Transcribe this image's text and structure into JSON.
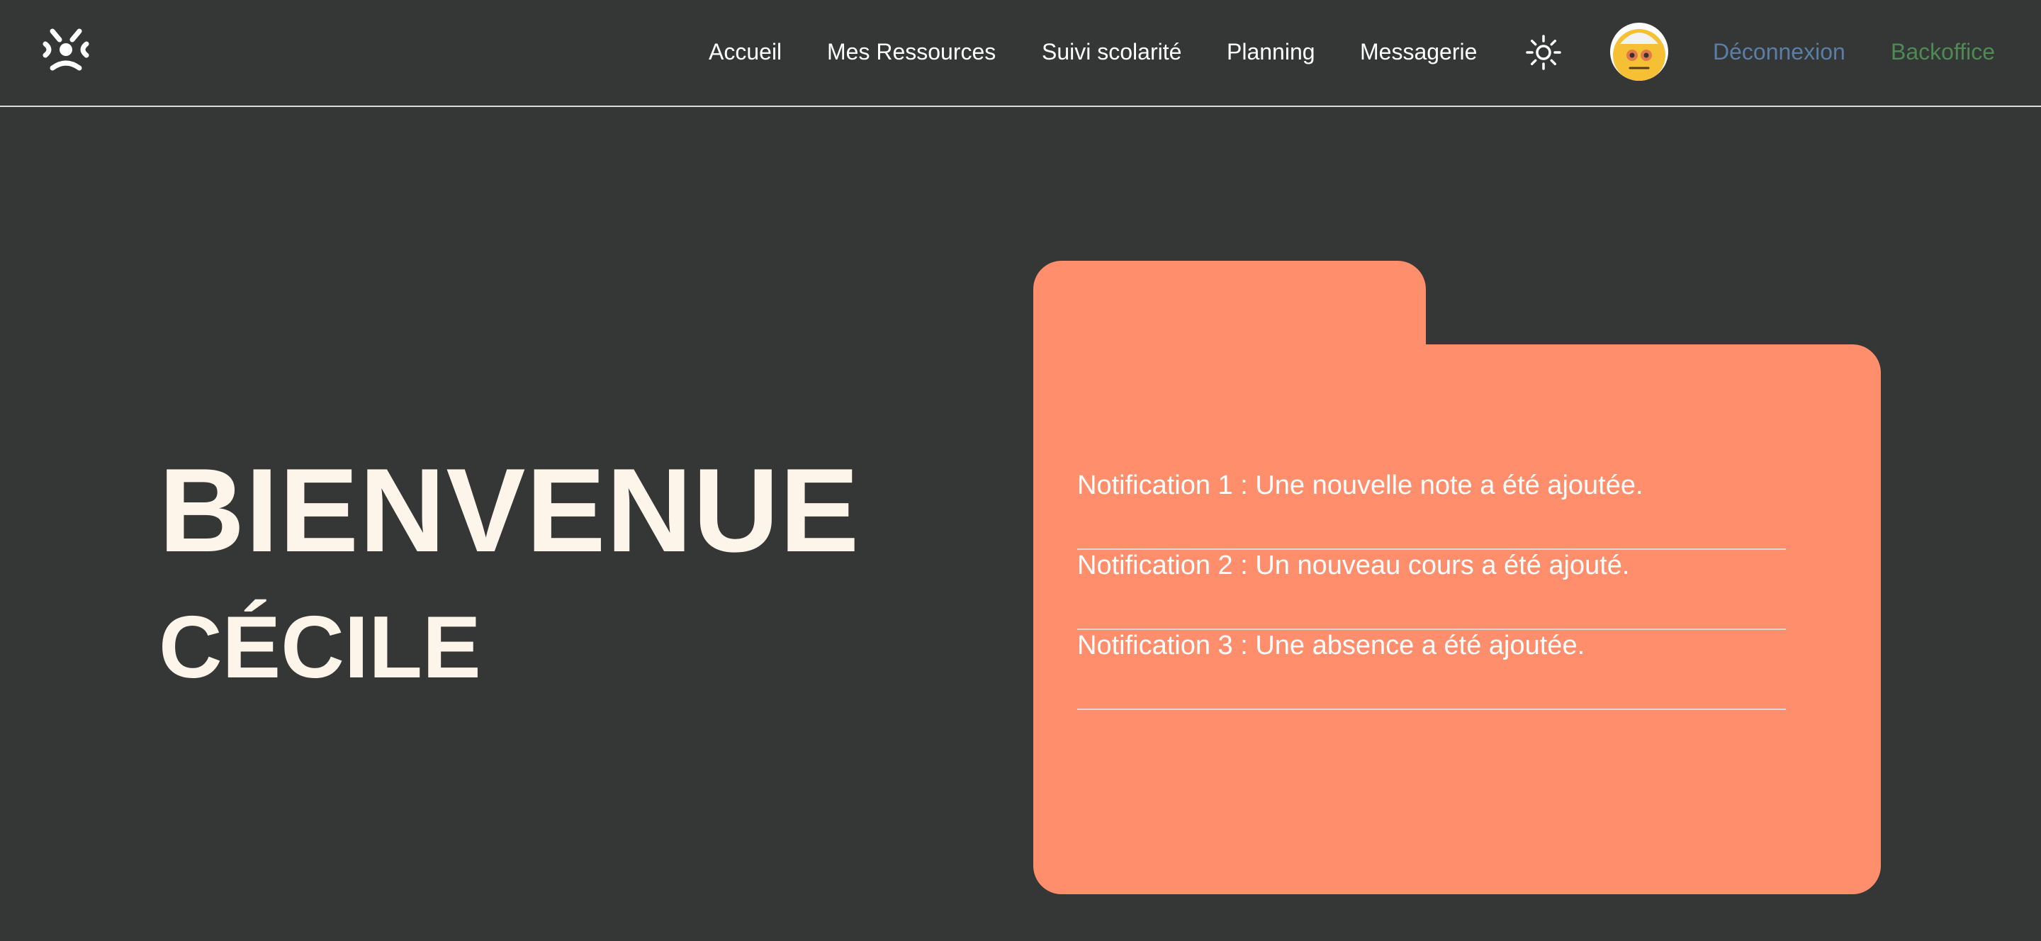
{
  "header": {
    "logo_icon": "app-logo-icon",
    "nav": [
      "Accueil",
      "Mes Ressources",
      "Suivi scolarité",
      "Planning",
      "Messagerie"
    ],
    "theme_toggle_icon": "sun-icon",
    "avatar_icon": "emoji-avatar",
    "logout_label": "Déconnexion",
    "backoffice_label": "Backoffice"
  },
  "hero": {
    "welcome": "BIENVENUE",
    "name": "CÉCILE"
  },
  "notifications": [
    "Notification 1 : Une nouvelle note a été ajoutée.",
    "Notification 2 : Un nouveau cours a été ajouté.",
    "Notification 3 : Une absence a été ajoutée."
  ],
  "colors": {
    "background": "#353636",
    "folder": "#ff8e6c",
    "hero_text": "#fdf4ea",
    "logout": "#5a7fa6",
    "backoffice": "#4f8a55"
  }
}
